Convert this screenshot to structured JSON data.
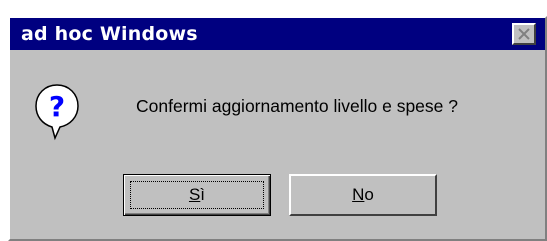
{
  "window": {
    "title": "ad hoc Windows"
  },
  "message": {
    "text": "Confermi aggiornamento livello e spese ?",
    "icon": "question-icon"
  },
  "buttons": {
    "yes": {
      "mnemonic": "S",
      "rest": "ì"
    },
    "no": {
      "mnemonic": "N",
      "rest": "o"
    }
  },
  "colors": {
    "titlebar": "#000080",
    "face": "#c0c0c0",
    "icon_accent": "#0000ff"
  }
}
